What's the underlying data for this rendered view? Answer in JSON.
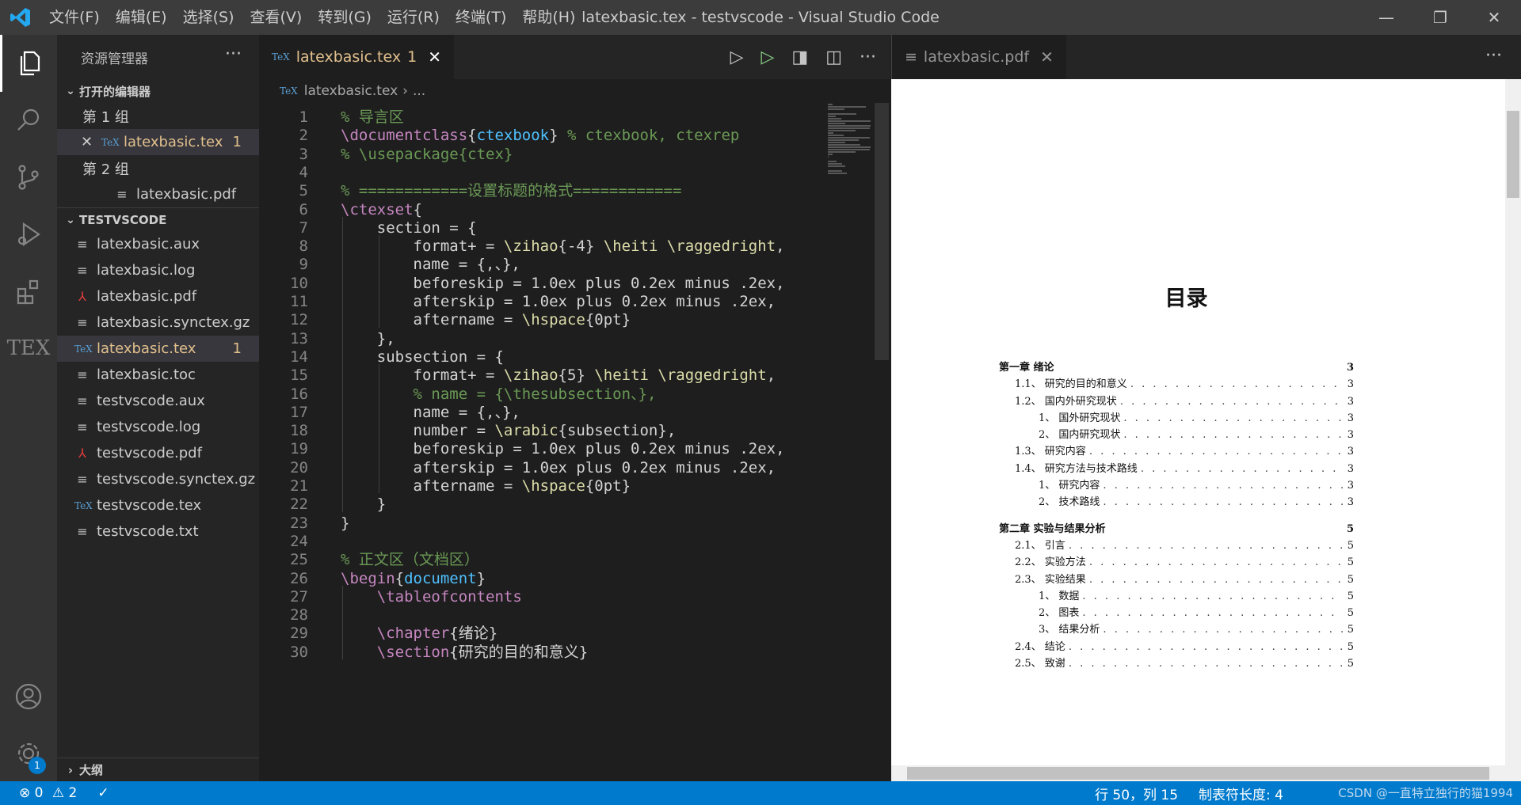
{
  "window": {
    "title": "latexbasic.tex - testvscode - Visual Studio Code",
    "menu": [
      "文件(F)",
      "编辑(E)",
      "选择(S)",
      "查看(V)",
      "转到(G)",
      "运行(R)",
      "终端(T)",
      "帮助(H)"
    ],
    "controls": {
      "minimize": "—",
      "restore": "❐",
      "close": "✕"
    }
  },
  "activity_bar": {
    "items": [
      "explorer-icon",
      "search-icon",
      "source-control-icon",
      "run-debug-icon",
      "extensions-icon",
      "tex-icon"
    ],
    "tex_label": "TEX",
    "bottom": [
      "account-icon",
      "settings-icon"
    ],
    "settings_badge": "1"
  },
  "sidebar": {
    "title": "资源管理器",
    "more": "···",
    "open_editors": {
      "header": "打开的编辑器",
      "group1": "第 1 组",
      "group1_file": "latexbasic.tex",
      "group1_file_count": "1",
      "group2": "第 2 组",
      "group2_file": "latexbasic.pdf"
    },
    "folder": {
      "header": "TESTVSCODE",
      "files": [
        {
          "name": "latexbasic.aux",
          "type": "file"
        },
        {
          "name": "latexbasic.log",
          "type": "file"
        },
        {
          "name": "latexbasic.pdf",
          "type": "pdf"
        },
        {
          "name": "latexbasic.synctex.gz",
          "type": "file"
        },
        {
          "name": "latexbasic.tex",
          "type": "tex",
          "count": "1"
        },
        {
          "name": "latexbasic.toc",
          "type": "file"
        },
        {
          "name": "testvscode.aux",
          "type": "file"
        },
        {
          "name": "testvscode.log",
          "type": "file"
        },
        {
          "name": "testvscode.pdf",
          "type": "pdf"
        },
        {
          "name": "testvscode.synctex.gz",
          "type": "file"
        },
        {
          "name": "testvscode.tex",
          "type": "tex"
        },
        {
          "name": "testvscode.txt",
          "type": "file"
        }
      ]
    },
    "outline": "大纲"
  },
  "editor1": {
    "tab_label": "latexbasic.tex",
    "tab_count": "1",
    "breadcrumb_file": "latexbasic.tex",
    "breadcrumb_more": "...",
    "lines": [
      {
        "n": "1",
        "code": "% 导言区"
      },
      {
        "n": "2",
        "code": "\\documentclass{ctexbook} % ctexbook, ctexrep"
      },
      {
        "n": "3",
        "code": "% \\usepackage{ctex}"
      },
      {
        "n": "4",
        "code": ""
      },
      {
        "n": "5",
        "code": "% ============设置标题的格式============"
      },
      {
        "n": "6",
        "code": "\\ctexset{"
      },
      {
        "n": "7",
        "code": "    section = {"
      },
      {
        "n": "8",
        "code": "        format+ = \\zihao{-4} \\heiti \\raggedright,"
      },
      {
        "n": "9",
        "code": "        name = {,、},"
      },
      {
        "n": "10",
        "code": "        beforeskip = 1.0ex plus 0.2ex minus .2ex,"
      },
      {
        "n": "11",
        "code": "        afterskip = 1.0ex plus 0.2ex minus .2ex,"
      },
      {
        "n": "12",
        "code": "        aftername = \\hspace{0pt}"
      },
      {
        "n": "13",
        "code": "    },"
      },
      {
        "n": "14",
        "code": "    subsection = {"
      },
      {
        "n": "15",
        "code": "        format+ = \\zihao{5} \\heiti \\raggedright,"
      },
      {
        "n": "16",
        "code": "        % name = {\\thesubsection、},"
      },
      {
        "n": "17",
        "code": "        name = {,、},"
      },
      {
        "n": "18",
        "code": "        number = \\arabic{subsection},"
      },
      {
        "n": "19",
        "code": "        beforeskip = 1.0ex plus 0.2ex minus .2ex,"
      },
      {
        "n": "20",
        "code": "        afterskip = 1.0ex plus 0.2ex minus .2ex,"
      },
      {
        "n": "21",
        "code": "        aftername = \\hspace{0pt}"
      },
      {
        "n": "22",
        "code": "    }"
      },
      {
        "n": "23",
        "code": "}"
      },
      {
        "n": "24",
        "code": ""
      },
      {
        "n": "25",
        "code": "% 正文区（文档区）"
      },
      {
        "n": "26",
        "code": "\\begin{document}"
      },
      {
        "n": "27",
        "code": "    \\tableofcontents"
      },
      {
        "n": "28",
        "code": ""
      },
      {
        "n": "29",
        "code": "    \\chapter{绪论}"
      },
      {
        "n": "30",
        "code": "    \\section{研究的目的和意义}"
      }
    ]
  },
  "editor2": {
    "tab_label": "latexbasic.pdf",
    "more": "···",
    "pdf": {
      "title": "目录",
      "entries": [
        {
          "t": "第一章   绪论",
          "p": "3",
          "level": 0
        },
        {
          "t": "1.1、  研究的目的和意义",
          "p": "3",
          "level": 1
        },
        {
          "t": "1.2、  国内外研究现状",
          "p": "3",
          "level": 1
        },
        {
          "t": "1、      国外研究现状",
          "p": "3",
          "level": 2
        },
        {
          "t": "2、      国内研究现状",
          "p": "3",
          "level": 2
        },
        {
          "t": "1.3、  研究内容",
          "p": "3",
          "level": 1
        },
        {
          "t": "1.4、  研究方法与技术路线",
          "p": "3",
          "level": 1
        },
        {
          "t": "1、      研究内容",
          "p": "3",
          "level": 2
        },
        {
          "t": "2、      技术路线",
          "p": "3",
          "level": 2
        },
        {
          "t": "第二章   实验与结果分析",
          "p": "5",
          "level": 0
        },
        {
          "t": "2.1、  引言",
          "p": "5",
          "level": 1
        },
        {
          "t": "2.2、  实验方法",
          "p": "5",
          "level": 1
        },
        {
          "t": "2.3、  实验结果",
          "p": "5",
          "level": 1
        },
        {
          "t": "1、      数据",
          "p": "5",
          "level": 2
        },
        {
          "t": "2、      图表",
          "p": "5",
          "level": 2
        },
        {
          "t": "3、      结果分析",
          "p": "5",
          "level": 2
        },
        {
          "t": "2.4、  结论",
          "p": "5",
          "level": 1
        },
        {
          "t": "2.5、  致谢",
          "p": "5",
          "level": 1
        }
      ]
    }
  },
  "statusbar": {
    "errors": "0",
    "warnings": "2",
    "position": "行 50，列 15",
    "tab_size": "制表符长度: 4",
    "watermark": "CSDN @一直特立独行的猫1994"
  },
  "colors": {
    "accent": "#007acc",
    "modified": "#e2c08d",
    "comment": "#6a9955",
    "keyword": "#c586c0"
  }
}
